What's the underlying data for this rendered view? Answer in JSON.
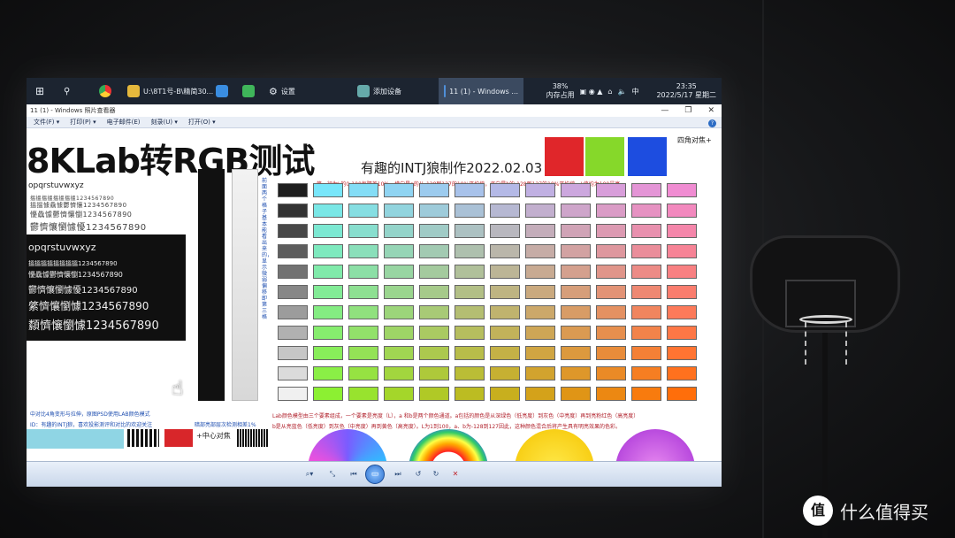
{
  "taskbar": {
    "items": [
      "U:\\8T1号-B\\精简30...",
      "设置",
      "添加设备",
      "11 (1) - Windows ..."
    ],
    "memory": {
      "value": "38%",
      "label": "内存占用"
    },
    "ime": "中",
    "time": "23:35",
    "date": "2022/5/17 星期二"
  },
  "window": {
    "title": "11 (1) - Windows 照片查看器",
    "menu": [
      "文件(F) ▾",
      "打印(P) ▾",
      "电子邮件(E)",
      "刻录(U) ▾",
      "打开(O) ▾"
    ],
    "help": "?"
  },
  "image": {
    "big_title": "8KLab转RGB测试",
    "sub_title": "有趣的INTJ狼制作2022.02.03",
    "corner_label": "四角对焦+",
    "lab_note1": "第一行为L的0-100每隔差10%。横向是a的从-128到127的10%平均值，竖向是b的-128到127的10%平均值，L值均为100最亮",
    "latin_sample": "opqrstuvwxyz",
    "chinese_sample_lines": [
      "搵搵搵搵搵搵搵搵1234567890",
      "搵搵懅驫懅鬱懠懹1234567890",
      "懮驫懅鬱懠懹懰1234567890",
      "鬱懠懹懰懅懮1234567890",
      "綮懠懹懰懅1234567890",
      "纇懠懹懰懅1234567890"
    ],
    "vert_note": "前面两个格子基本能看出来的，显示微弱偏移即第三格",
    "lab_note2": "Lab颜色模型由三个要素组成，一个要素是亮度（L），a 和b是两个颜色通道。a包括的颜色是从深绿色（低亮度）到灰色（中亮度）再到亮粉红色（高亮度）",
    "lab_note3": "b是从亮蓝色（低亮度）到灰色（中亮度）再到黄色（高亮度）。L为1到100，a、b为-128到127因此，这种颜色混合后将产生具有明亮效果的色彩。",
    "left_note1": "中对比4角变形与拉伸，原图PSD使用LAB颜色模式",
    "left_note2": "ID：有趣的INTJ狼，喜欢投影测评和对比的欢迎关注",
    "bottom_note": "暗部亮部层次检测相差1%",
    "center_label": "+中心对焦"
  },
  "viewer_toolbar": {
    "zoom": "⌕▾",
    "fit": "⤡",
    "prev": "⏮",
    "play": "▭",
    "next": "⏭",
    "rotate_ccw": "↺",
    "rotate_cw": "↻",
    "delete": "✕"
  },
  "watermark": {
    "logo": "值",
    "text": "什么值得买"
  },
  "colors": {
    "red": "#e0262a",
    "green": "#86d82a",
    "blue": "#1d4de0"
  }
}
